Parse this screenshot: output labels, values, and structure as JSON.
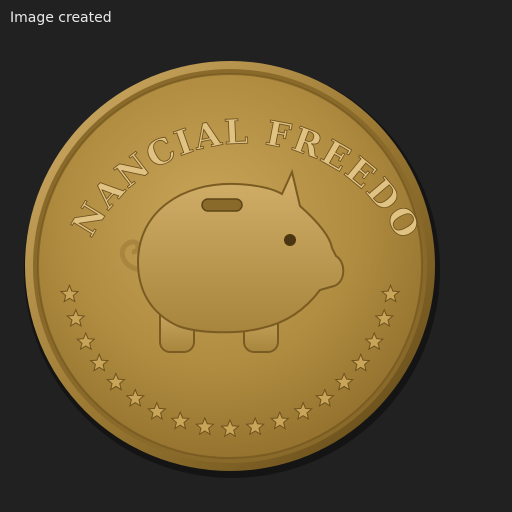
{
  "status": {
    "label": "Image created"
  },
  "coin": {
    "inscription": "FINANCIAL FREEDOM",
    "emblem_icon": "piggy-bank-icon",
    "star_icon": "star-icon",
    "star_count": 19
  },
  "colors": {
    "background": "#212121",
    "status_text": "#e8e8e8",
    "coin_light": "#c9a55a",
    "coin_mid": "#a98537",
    "coin_dark": "#6e521c"
  }
}
